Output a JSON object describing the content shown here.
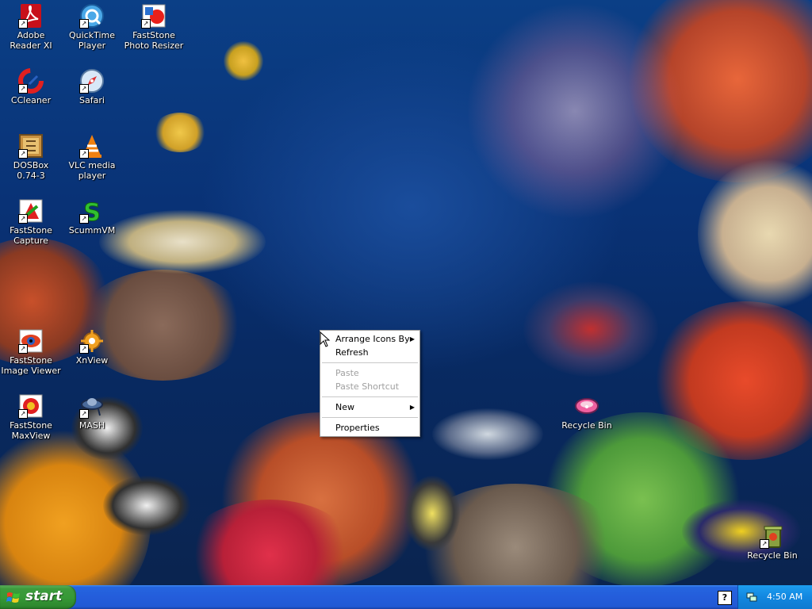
{
  "desktop_icons": [
    {
      "label": "Adobe Reader XI",
      "icon": "adobe-reader-icon"
    },
    {
      "label": "QuickTime Player",
      "icon": "quicktime-icon"
    },
    {
      "label": "FastStone Photo Resizer",
      "icon": "faststone-photo-resizer-icon"
    },
    {
      "label": "CCleaner",
      "icon": "ccleaner-icon"
    },
    {
      "label": "Safari",
      "icon": "safari-icon"
    },
    {
      "label": "DOSBox 0.74-3",
      "icon": "dosbox-icon"
    },
    {
      "label": "VLC media player",
      "icon": "vlc-icon"
    },
    {
      "label": "FastStone Capture",
      "icon": "faststone-capture-icon"
    },
    {
      "label": "ScummVM",
      "icon": "scummvm-icon"
    },
    {
      "label": "FastStone Image Viewer",
      "icon": "faststone-image-viewer-icon"
    },
    {
      "label": "XnView",
      "icon": "xnview-icon"
    },
    {
      "label": "FastStone MaxView",
      "icon": "faststone-maxview-icon"
    },
    {
      "label": "MASH",
      "icon": "mash-icon"
    },
    {
      "label": "Recycle Bin",
      "icon": "recycle-bin-icon"
    },
    {
      "label": "Recycle Bin",
      "icon": "recycle-bin-icon"
    }
  ],
  "context_menu": {
    "arrange_icons_by": "Arrange Icons By",
    "refresh": "Refresh",
    "paste": "Paste",
    "paste_shortcut": "Paste Shortcut",
    "new": "New",
    "properties": "Properties",
    "submenu_arrow": "▶"
  },
  "taskbar": {
    "start_label": "start",
    "help_glyph": "?",
    "clock": "4:50 AM"
  },
  "colors": {
    "taskbar_blue": "#245ddb",
    "start_green": "#379a37",
    "tray_blue": "#1287e0"
  }
}
